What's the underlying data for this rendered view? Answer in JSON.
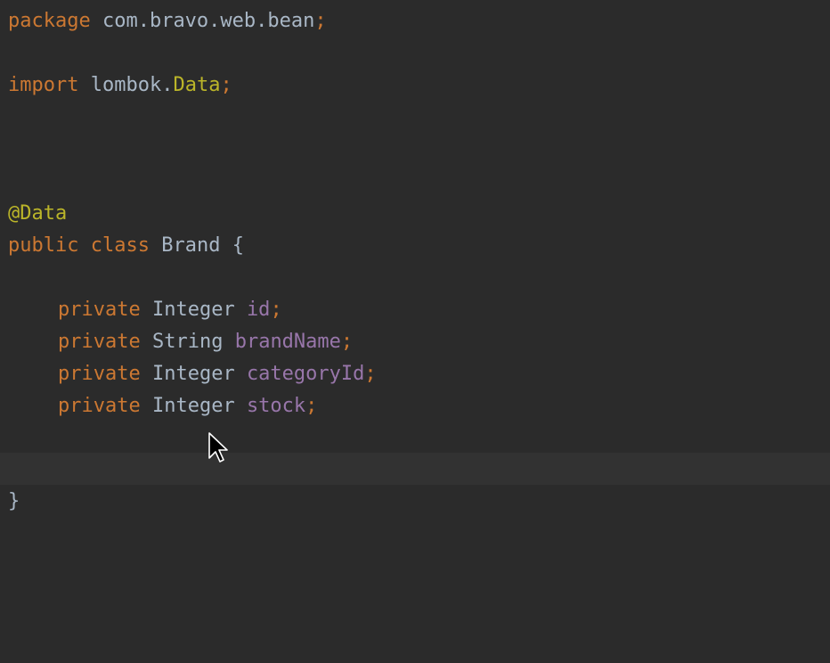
{
  "code": {
    "package_kw": "package",
    "package_name": "com.bravo.web.bean",
    "semicolon": ";",
    "import_kw": "import",
    "import_pkg": "lombok.",
    "import_class": "Data",
    "annotation": "@Data",
    "public_kw": "public",
    "class_kw": "class",
    "class_name": "Brand",
    "open_brace": "{",
    "close_brace": "}",
    "private_kw": "private",
    "fields": [
      {
        "type": "Integer",
        "name": "id"
      },
      {
        "type": "String",
        "name": "brandName"
      },
      {
        "type": "Integer",
        "name": "categoryId"
      },
      {
        "type": "Integer",
        "name": "stock"
      }
    ]
  },
  "colors": {
    "background": "#2b2b2b",
    "current_line": "#323232",
    "keyword": "#cc7832",
    "annotation": "#bbb529",
    "field": "#9876aa",
    "text": "#a9b7c6"
  },
  "icons": {
    "cursor": "mouse-pointer-icon"
  }
}
